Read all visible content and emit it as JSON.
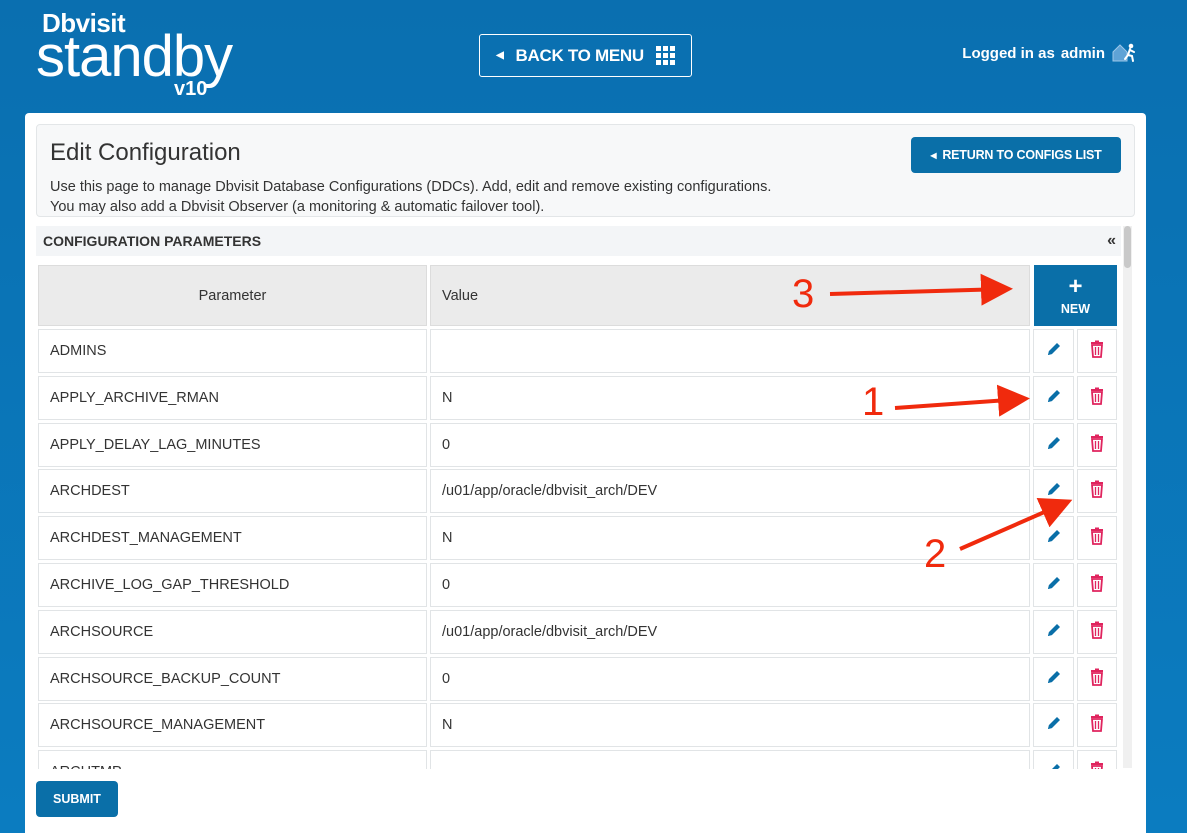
{
  "header": {
    "brand": "Dbvisit",
    "product": "standby",
    "version": "v10",
    "back_button": "BACK TO MENU",
    "login_prefix": "Logged in as",
    "login_user": "admin"
  },
  "intro": {
    "title": "Edit Configuration",
    "line1": "Use this page to manage Dbvisit Database Configurations (DDCs). Add, edit and remove existing configurations.",
    "line2": "You may also add a Dbvisit Observer (a monitoring & automatic failover tool).",
    "return_button": "RETURN TO CONFIGS LIST"
  },
  "section": {
    "title": "CONFIGURATION PARAMETERS",
    "collapse": "«"
  },
  "table": {
    "col_parameter": "Parameter",
    "col_value": "Value",
    "new_plus": "+",
    "new_label": "NEW",
    "rows": [
      {
        "param": "ADMINS",
        "value": ""
      },
      {
        "param": "APPLY_ARCHIVE_RMAN",
        "value": "N"
      },
      {
        "param": "APPLY_DELAY_LAG_MINUTES",
        "value": "0"
      },
      {
        "param": "ARCHDEST",
        "value": "/u01/app/oracle/dbvisit_arch/DEV"
      },
      {
        "param": "ARCHDEST_MANAGEMENT",
        "value": "N"
      },
      {
        "param": "ARCHIVE_LOG_GAP_THRESHOLD",
        "value": "0"
      },
      {
        "param": "ARCHSOURCE",
        "value": "/u01/app/oracle/dbvisit_arch/DEV"
      },
      {
        "param": "ARCHSOURCE_BACKUP_COUNT",
        "value": "0"
      },
      {
        "param": "ARCHSOURCE_MANAGEMENT",
        "value": "N"
      },
      {
        "param": "ARCHTMP",
        "value": ""
      }
    ]
  },
  "submit": "SUBMIT",
  "annotations": {
    "a1": "1",
    "a2": "2",
    "a3": "3"
  },
  "colors": {
    "primary": "#0a6fa8",
    "delete": "#e0245e",
    "annotation": "#f02a0d"
  },
  "icons": {
    "edit": "pencil-icon",
    "delete": "trash-icon",
    "menu": "grid-icon",
    "logout": "house-runner-icon"
  }
}
